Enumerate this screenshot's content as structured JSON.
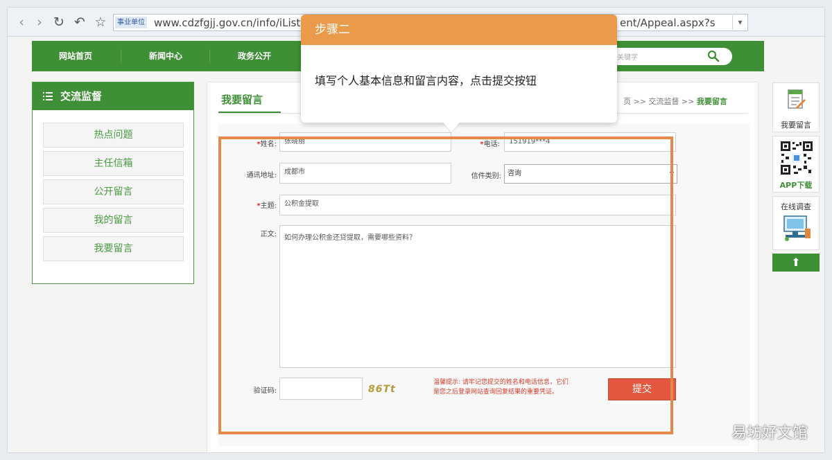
{
  "browser": {
    "url_badge": "事业单位",
    "url_left": "www.cdzfgjj.gov.cn/info/iList.jsp",
    "url_right": "ent/Appeal.aspx?s"
  },
  "site_nav": {
    "items": [
      "网站首页",
      "新闻中心",
      "政务公开"
    ],
    "search_placeholder": "关键字"
  },
  "left_panel": {
    "title": "交流监督",
    "items": [
      "热点问题",
      "主任信箱",
      "公开留言",
      "我的留言",
      "我要留言"
    ]
  },
  "main": {
    "title": "我要留言",
    "breadcrumb_prefix": "页 >> 交流监督 >> ",
    "breadcrumb_current": "我要留言"
  },
  "form": {
    "name_label": "姓名:",
    "name_value": "张晓丽",
    "phone_label": "电话:",
    "phone_value": "151919***4",
    "address_label": "通讯地址:",
    "address_value": "成都市",
    "category_label": "信件类别:",
    "category_value": "咨询",
    "subject_label": "主题:",
    "subject_value": "公积金提取",
    "body_label": "正文:",
    "body_value": "如何办理公积金还贷提取，需要哪些资料？",
    "captcha_label": "验证码:",
    "captcha_value": "",
    "captcha_image_text": "86Tt",
    "hint_line1": "温馨提示: 请牢记您提交的姓名和电话信息，它们",
    "hint_line2": "是您之后登录网站查询回复结果的重要凭证。",
    "submit_label": "提交",
    "required_mark": "*"
  },
  "side_tools": {
    "leave_message": "我要留言",
    "app_download": "APP下载",
    "online_survey": "在线调查",
    "up_arrow": "⬆"
  },
  "callout": {
    "title": "步骤二",
    "text": "填写个人基本信息和留言内容，点击提交按钮"
  },
  "watermark": "易坊好文馆",
  "colors": {
    "brand_green": "#3e8f35",
    "callout_orange": "#e99a4a",
    "highlight_frame": "#e4884b",
    "submit_red": "#e3583f"
  }
}
